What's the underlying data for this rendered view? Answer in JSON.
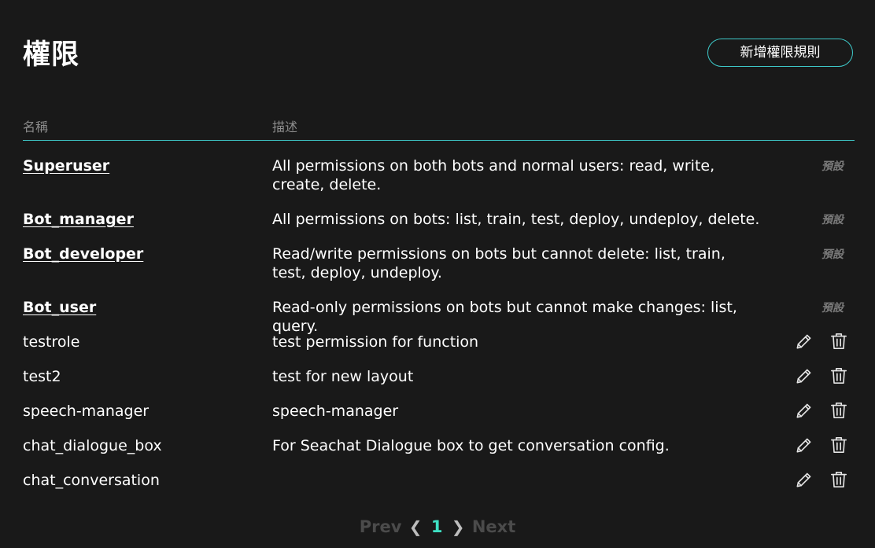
{
  "page": {
    "title": "權限",
    "add_button_label": "新增權限規則"
  },
  "table": {
    "headers": {
      "name": "名稱",
      "description": "描述"
    },
    "default_tag": "預設",
    "rows": [
      {
        "name": "Superuser",
        "description": "All permissions on both bots and normal users: read, write, create, delete.",
        "is_default": true
      },
      {
        "name": "Bot_manager",
        "description": "All permissions on bots: list, train, test, deploy, undeploy, delete.",
        "is_default": true
      },
      {
        "name": "Bot_developer",
        "description": "Read/write permissions on bots but cannot delete: list, train, test, deploy, undeploy.",
        "is_default": true
      },
      {
        "name": "Bot_user",
        "description": "Read-only permissions on bots but cannot make changes: list, query.",
        "is_default": true
      },
      {
        "name": "testrole",
        "description": "test permission for function",
        "is_default": false
      },
      {
        "name": "test2",
        "description": "test for new layout",
        "is_default": false
      },
      {
        "name": "speech-manager",
        "description": "speech-manager",
        "is_default": false
      },
      {
        "name": "chat_dialogue_box",
        "description": "For Seachat Dialogue box to get conversation config.",
        "is_default": false
      },
      {
        "name": "chat_conversation",
        "description": "",
        "is_default": false
      }
    ]
  },
  "icons": {
    "edit": "pencil-icon",
    "delete": "trash-icon",
    "prev_chevron": "chevron-left-icon",
    "next_chevron": "chevron-right-icon"
  },
  "pagination": {
    "prev_label": "Prev",
    "current_page": "1",
    "next_label": "Next"
  },
  "colors": {
    "background": "#191919",
    "accent": "#3ec9c9",
    "current_page": "#3ee0c4",
    "muted_text": "#8c8c8c"
  }
}
